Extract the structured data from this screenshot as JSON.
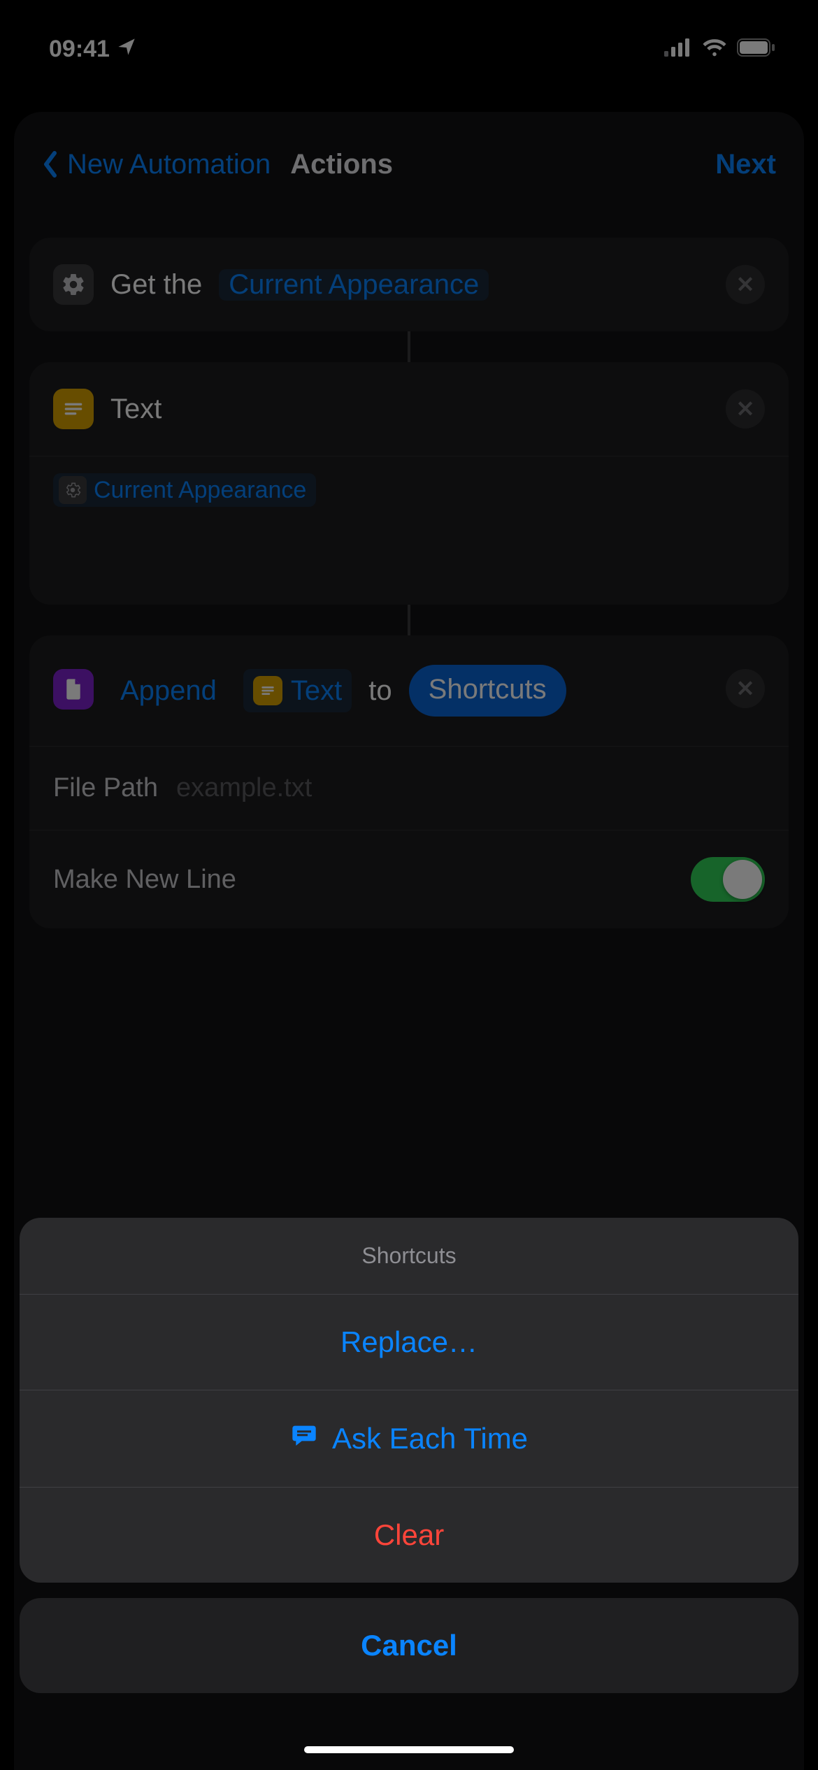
{
  "status": {
    "time": "09:41",
    "carrier_icon": "cellular",
    "wifi_icon": "wifi",
    "battery_icon": "battery-full"
  },
  "nav": {
    "back_label": "New Automation",
    "title": "Actions",
    "next_label": "Next"
  },
  "actions": [
    {
      "prefix": "Get the",
      "token": "Current Appearance"
    },
    {
      "title": "Text",
      "variable": "Current Appearance"
    },
    {
      "verb": "Append",
      "input_token": "Text",
      "joiner": "to",
      "destination": "Shortcuts",
      "params": {
        "file_path_label": "File Path",
        "file_path_placeholder": "example.txt",
        "new_line_label": "Make New Line",
        "new_line_on": true
      }
    }
  ],
  "sheet": {
    "title": "Shortcuts",
    "replace": "Replace…",
    "ask": "Ask Each Time",
    "clear": "Clear",
    "cancel": "Cancel"
  }
}
